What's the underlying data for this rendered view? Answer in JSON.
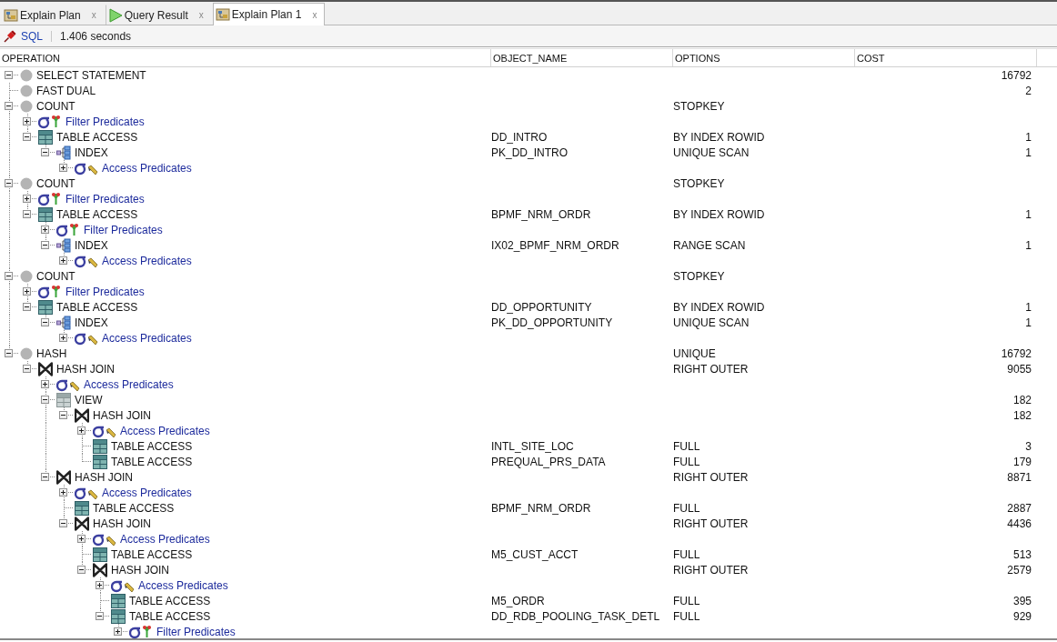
{
  "tabs": [
    {
      "label": "Explain Plan",
      "close": "x",
      "kind": "plan",
      "selected": false
    },
    {
      "label": "Query Result",
      "close": "x",
      "kind": "result",
      "selected": false
    },
    {
      "label": "Explain Plan 1",
      "close": "x",
      "kind": "plan",
      "selected": true
    }
  ],
  "toolbar": {
    "link": "SQL",
    "elapsed": "1.406 seconds"
  },
  "columns": [
    "OPERATION",
    "OBJECT_NAME",
    "OPTIONS",
    "COST"
  ],
  "plan": [
    {
      "operation": "SELECT STATEMENT",
      "kind": "circle",
      "cost": "16792",
      "expanded": true,
      "children": [
        {
          "operation": "FAST DUAL",
          "kind": "circle",
          "cost": "2"
        },
        {
          "operation": "COUNT",
          "kind": "circle",
          "options": "STOPKEY",
          "expanded": true,
          "children": [
            {
              "operation": "Filter Predicates",
              "kind": "filter",
              "expanded": false
            },
            {
              "operation": "TABLE ACCESS",
              "kind": "table",
              "object_name": "DD_INTRO",
              "options": "BY INDEX ROWID",
              "cost": "1",
              "expanded": true,
              "children": [
                {
                  "operation": "INDEX",
                  "kind": "index",
                  "object_name": "PK_DD_INTRO",
                  "options": "UNIQUE SCAN",
                  "cost": "1",
                  "expanded": true,
                  "children": [
                    {
                      "operation": "Access Predicates",
                      "kind": "access",
                      "expanded": false
                    }
                  ]
                }
              ]
            }
          ]
        },
        {
          "operation": "COUNT",
          "kind": "circle",
          "options": "STOPKEY",
          "expanded": true,
          "children": [
            {
              "operation": "Filter Predicates",
              "kind": "filter",
              "expanded": false
            },
            {
              "operation": "TABLE ACCESS",
              "kind": "table",
              "object_name": "BPMF_NRM_ORDR",
              "options": "BY INDEX ROWID",
              "cost": "1",
              "expanded": true,
              "children": [
                {
                  "operation": "Filter Predicates",
                  "kind": "filter",
                  "expanded": false
                },
                {
                  "operation": "INDEX",
                  "kind": "index",
                  "object_name": "IX02_BPMF_NRM_ORDR",
                  "options": "RANGE SCAN",
                  "cost": "1",
                  "expanded": true,
                  "children": [
                    {
                      "operation": "Access Predicates",
                      "kind": "access",
                      "expanded": false
                    }
                  ]
                }
              ]
            }
          ]
        },
        {
          "operation": "COUNT",
          "kind": "circle",
          "options": "STOPKEY",
          "expanded": true,
          "children": [
            {
              "operation": "Filter Predicates",
              "kind": "filter",
              "expanded": false
            },
            {
              "operation": "TABLE ACCESS",
              "kind": "table",
              "object_name": "DD_OPPORTUNITY",
              "options": "BY INDEX ROWID",
              "cost": "1",
              "expanded": true,
              "children": [
                {
                  "operation": "INDEX",
                  "kind": "index",
                  "object_name": "PK_DD_OPPORTUNITY",
                  "options": "UNIQUE SCAN",
                  "cost": "1",
                  "expanded": true,
                  "children": [
                    {
                      "operation": "Access Predicates",
                      "kind": "access",
                      "expanded": false
                    }
                  ]
                }
              ]
            }
          ]
        },
        {
          "operation": "HASH",
          "kind": "circle",
          "options": "UNIQUE",
          "cost": "16792",
          "expanded": true,
          "children": [
            {
              "operation": "HASH JOIN",
              "kind": "join",
              "options": "RIGHT OUTER",
              "cost": "9055",
              "expanded": true,
              "children": [
                {
                  "operation": "Access Predicates",
                  "kind": "access",
                  "expanded": false
                },
                {
                  "operation": "VIEW",
                  "kind": "view",
                  "cost": "182",
                  "expanded": true,
                  "children": [
                    {
                      "operation": "HASH JOIN",
                      "kind": "join",
                      "cost": "182",
                      "expanded": true,
                      "children": [
                        {
                          "operation": "Access Predicates",
                          "kind": "access",
                          "expanded": false
                        },
                        {
                          "operation": "TABLE ACCESS",
                          "kind": "table",
                          "object_name": "INTL_SITE_LOC",
                          "options": "FULL",
                          "cost": "3"
                        },
                        {
                          "operation": "TABLE ACCESS",
                          "kind": "table",
                          "object_name": "PREQUAL_PRS_DATA",
                          "options": "FULL",
                          "cost": "179"
                        }
                      ]
                    }
                  ]
                },
                {
                  "operation": "HASH JOIN",
                  "kind": "join",
                  "options": "RIGHT OUTER",
                  "cost": "8871",
                  "expanded": true,
                  "children": [
                    {
                      "operation": "Access Predicates",
                      "kind": "access",
                      "expanded": false
                    },
                    {
                      "operation": "TABLE ACCESS",
                      "kind": "table",
                      "object_name": "BPMF_NRM_ORDR",
                      "options": "FULL",
                      "cost": "2887"
                    },
                    {
                      "operation": "HASH JOIN",
                      "kind": "join",
                      "options": "RIGHT OUTER",
                      "cost": "4436",
                      "expanded": true,
                      "children": [
                        {
                          "operation": "Access Predicates",
                          "kind": "access",
                          "expanded": false
                        },
                        {
                          "operation": "TABLE ACCESS",
                          "kind": "table",
                          "object_name": "M5_CUST_ACCT",
                          "options": "FULL",
                          "cost": "513"
                        },
                        {
                          "operation": "HASH JOIN",
                          "kind": "join",
                          "options": "RIGHT OUTER",
                          "cost": "2579",
                          "expanded": true,
                          "children": [
                            {
                              "operation": "Access Predicates",
                              "kind": "access",
                              "expanded": false
                            },
                            {
                              "operation": "TABLE ACCESS",
                              "kind": "table",
                              "object_name": "M5_ORDR",
                              "options": "FULL",
                              "cost": "395"
                            },
                            {
                              "operation": "TABLE ACCESS",
                              "kind": "table",
                              "object_name": "DD_RDB_POOLING_TASK_DETL",
                              "options": "FULL",
                              "cost": "929",
                              "expanded": true,
                              "children": [
                                {
                                  "operation": "Filter Predicates",
                                  "kind": "filter",
                                  "expanded": false
                                }
                              ]
                            }
                          ]
                        }
                      ]
                    }
                  ]
                }
              ]
            }
          ]
        }
      ]
    }
  ]
}
